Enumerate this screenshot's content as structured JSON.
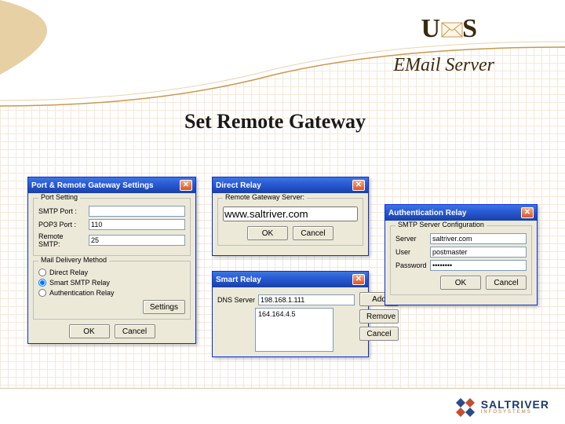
{
  "header": {
    "logo_text_left": "U",
    "logo_text_right": "S",
    "product": "EMail Server"
  },
  "page_title": "Set Remote Gateway",
  "dlg_port": {
    "title": "Port & Remote Gateway Settings",
    "grp_port": "Port Setting",
    "smtp_label": "SMTP Port :",
    "smtp_value": "",
    "pop3_label": "POP3 Port :",
    "pop3_value": "110",
    "remote_label": "Remote SMTP:",
    "remote_value": "25",
    "grp_mail": "Mail Delivery Method",
    "opt1": "Direct Relay",
    "opt2": "Smart SMTP Relay",
    "opt3": "Authentication Relay",
    "settings_btn": "Settings",
    "ok": "OK",
    "cancel": "Cancel"
  },
  "dlg_direct": {
    "title": "Direct Relay",
    "grp": "Remote Gateway Server:",
    "value": "www.saltriver.com",
    "ok": "OK",
    "cancel": "Cancel"
  },
  "dlg_smart": {
    "title": "Smart Relay",
    "dns_label": "DNS Server",
    "dns_value": "198.168.1.111",
    "list_item": "164.164.4.5",
    "add": "Add",
    "remove": "Remove",
    "cancel": "Cancel"
  },
  "dlg_auth": {
    "title": "Authentication Relay",
    "grp": "SMTP Server Configuration",
    "server_label": "Server",
    "server_value": "saltriver.com",
    "user_label": "User",
    "user_value": "postmaster",
    "pass_label": "Password",
    "pass_value": "••••••••",
    "ok": "OK",
    "cancel": "Cancel"
  },
  "footer": {
    "company": "SALTRIVER",
    "sub": "INFOSYSTEMS"
  }
}
